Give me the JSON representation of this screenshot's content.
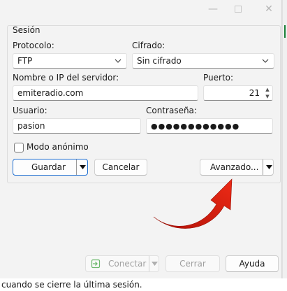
{
  "window": {
    "minimize_glyph": "—",
    "close_glyph": "✕"
  },
  "session": {
    "group_title": "Sesión",
    "protocol": {
      "label": "Protocolo:",
      "value": "FTP"
    },
    "encryption": {
      "label": "Cifrado:",
      "value": "Sin cifrado"
    },
    "host": {
      "label": "Nombre o IP del servidor:",
      "value": "emiteradio.com"
    },
    "port": {
      "label": "Puerto:",
      "value": "21"
    },
    "user": {
      "label": "Usuario:",
      "value": "pasion"
    },
    "password": {
      "label": "Contraseña:",
      "value": "●●●●●●●●●●●●"
    },
    "anonymous": {
      "label": "Modo anónimo",
      "checked": false
    },
    "save_label": "Guardar",
    "cancel_label": "Cancelar",
    "advanced_label": "Avanzado..."
  },
  "actions": {
    "connect_label": "Conectar",
    "close_label": "Cerrar",
    "help_label": "Ayuda"
  },
  "footer": {
    "text": "cuando se cierre la última sesión."
  },
  "colors": {
    "accent": "#1f6fd1",
    "annotation_arrow": "#d91f0f"
  },
  "icons": {
    "connect": "connect-icon",
    "dropdown": "chevron-down-icon",
    "annotation": "red-curved-arrow"
  }
}
